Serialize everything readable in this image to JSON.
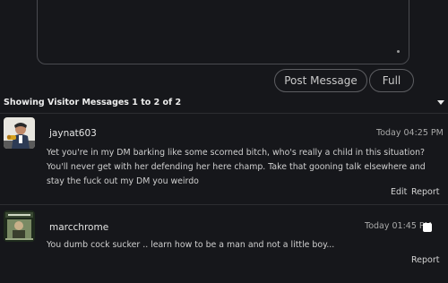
{
  "composer": {
    "post_label": "Post Message",
    "full_label": "Full"
  },
  "section": {
    "title": "Showing Visitor Messages 1 to 2 of 2"
  },
  "messages": [
    {
      "username": "jaynat603",
      "timestamp": "Today 04:25 PM",
      "text": "Yet you're in my DM barking like some scorned bitch, who's really a child in this situation? You'll never get with her defending her here champ. Take that gooning talk elsewhere and stay the fuck out my DM you weirdo",
      "actions": [
        "Edit",
        "Report"
      ]
    },
    {
      "username": "marcchrome",
      "timestamp": "Today 01:45 PM",
      "text": "You dumb cock sucker .. learn how to be a man and not a little boy...",
      "actions": [
        "Report"
      ]
    }
  ]
}
